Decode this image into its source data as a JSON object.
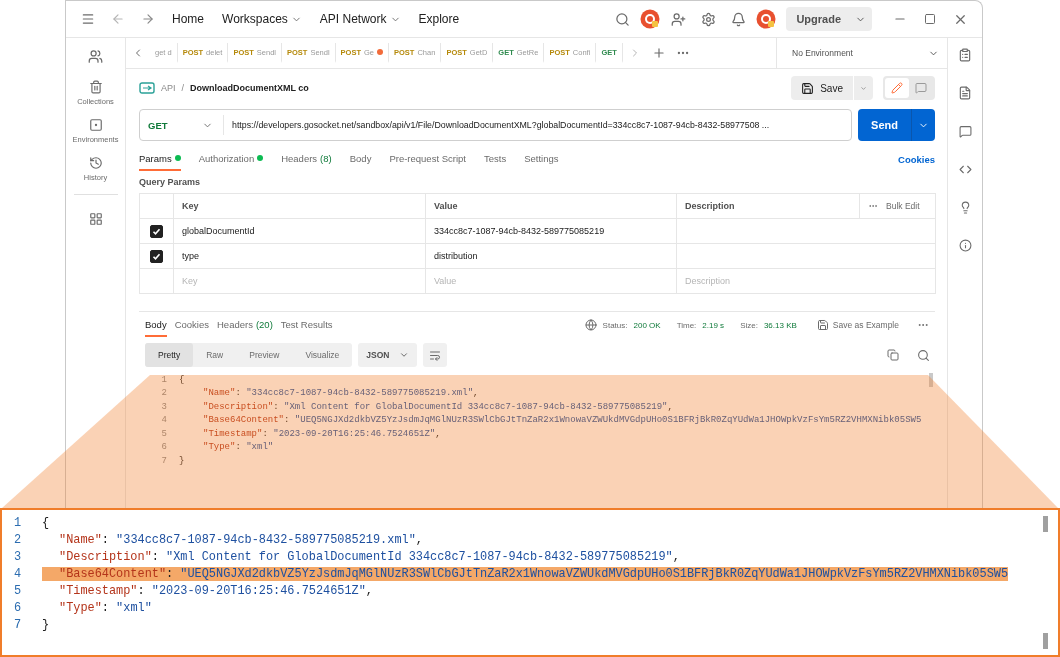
{
  "topbar": {
    "nav": [
      {
        "label": "Home",
        "dropdown": false
      },
      {
        "label": "Workspaces",
        "dropdown": true
      },
      {
        "label": "API Network",
        "dropdown": true
      },
      {
        "label": "Explore",
        "dropdown": false
      }
    ],
    "upgrade": "Upgrade"
  },
  "sidebar": {
    "items": [
      {
        "label": "Collections"
      },
      {
        "label": "Environments"
      },
      {
        "label": "History"
      }
    ]
  },
  "tabs": [
    {
      "name": "get d",
      "selected": false,
      "unsaved": false
    },
    {
      "method": "POST",
      "color": "#b5890a",
      "name": "delet",
      "selected": false,
      "unsaved": false
    },
    {
      "method": "POST",
      "color": "#b5890a",
      "name": "Sendl",
      "selected": false,
      "unsaved": false
    },
    {
      "method": "POST",
      "color": "#b5890a",
      "name": "Sendl",
      "selected": false,
      "unsaved": false
    },
    {
      "method": "POST",
      "color": "#b5890a",
      "name": "Ge",
      "selected": false,
      "unsaved": true
    },
    {
      "method": "POST",
      "color": "#b5890a",
      "name": "Chan",
      "selected": false,
      "unsaved": false
    },
    {
      "method": "POST",
      "color": "#b5890a",
      "name": "GetD",
      "selected": false,
      "unsaved": false
    },
    {
      "method": "GET",
      "color": "#2f8a4e",
      "name": "GetRe",
      "selected": false,
      "unsaved": false
    },
    {
      "method": "POST",
      "color": "#b5890a",
      "name": "Confi",
      "selected": false,
      "unsaved": false
    },
    {
      "method": "GET",
      "color": "#2f8a4e",
      "selected": false,
      "unsaved": false
    }
  ],
  "environment": "No Environment",
  "breadcrumb": {
    "parent": "API",
    "separator": "/",
    "name": "DownloadDocumentXML co"
  },
  "save": "Save",
  "request": {
    "method": "GET",
    "url": "https://developers.gosocket.net/sandbox/api/v1/File/DownloadDocumentXML?globalDocumentId=334cc8c7-1087-94cb-8432-58977508 ...",
    "send": "Send"
  },
  "request_tabs": [
    {
      "label": "Params",
      "dot": true,
      "selected": true
    },
    {
      "label": "Authorization",
      "dot": true,
      "selected": false
    },
    {
      "label": "Headers",
      "count": "(8)",
      "dot": false,
      "selected": false
    },
    {
      "label": "Body",
      "dot": false,
      "selected": false
    },
    {
      "label": "Pre-request Script",
      "dot": false,
      "selected": false
    },
    {
      "label": "Tests",
      "dot": false,
      "selected": false
    },
    {
      "label": "Settings",
      "dot": false,
      "selected": false
    }
  ],
  "cookies": "Cookies",
  "query_params": {
    "title": "Query Params",
    "columns": [
      "Key",
      "Value",
      "Description"
    ],
    "bulk_edit": "Bulk Edit",
    "rows": [
      {
        "checked": true,
        "key": "globalDocumentId",
        "value": "334cc8c7-1087-94cb-8432-589775085219"
      },
      {
        "checked": true,
        "key": "type",
        "value": "distribution"
      }
    ],
    "new_row": {
      "key_placeholder": "Key",
      "value_placeholder": "Value",
      "description_placeholder": "Description"
    }
  },
  "response": {
    "tabs": [
      {
        "label": "Body",
        "selected": true
      },
      {
        "label": "Cookies",
        "selected": false
      },
      {
        "label": "Headers",
        "count": "(20)",
        "selected": false
      },
      {
        "label": "Test Results",
        "selected": false
      }
    ],
    "status_label": "Status:",
    "status": "200 OK",
    "time_label": "Time:",
    "time": "2.19 s",
    "size_label": "Size:",
    "size": "36.13 KB",
    "save_example": "Save as Example",
    "view_modes": [
      {
        "label": "Pretty",
        "selected": true
      },
      {
        "label": "Raw",
        "selected": false
      },
      {
        "label": "Preview",
        "selected": false
      },
      {
        "label": "Visualize",
        "selected": false
      }
    ],
    "format": "JSON",
    "lines": [
      {
        "number": "1",
        "tokens": [
          {
            "kind": "punct",
            "text": "{"
          }
        ]
      },
      {
        "number": "2",
        "tokens": [
          {
            "kind": "key",
            "text": "\"Name\""
          },
          {
            "kind": "punct",
            "text": ": "
          },
          {
            "kind": "string",
            "text": "\"334cc8c7-1087-94cb-8432-589775085219.xml\""
          },
          {
            "kind": "punct",
            "text": ","
          }
        ]
      },
      {
        "number": "3",
        "tokens": [
          {
            "kind": "key",
            "text": "\"Description\""
          },
          {
            "kind": "punct",
            "text": ": "
          },
          {
            "kind": "string",
            "text": "\"Xml Content for GlobalDocumentId 334cc8c7-1087-94cb-8432-589775085219\""
          },
          {
            "kind": "punct",
            "text": ","
          }
        ]
      },
      {
        "number": "4",
        "tokens": [
          {
            "kind": "key",
            "text": "\"Base64Content\""
          },
          {
            "kind": "punct",
            "text": ": "
          },
          {
            "kind": "string",
            "text": "\"UEQ5NGJXd2dkbVZ5YzJsdmJqMGlNUzR3SWlCbGJtTnZaR2x1WnowaVZWUkdMVGdpUHo0S1BFRjBkR0ZqYUdWa1JHOWpkVzFsYm5RZ2VHMXNibk05SW5"
          }
        ]
      },
      {
        "number": "5",
        "tokens": [
          {
            "kind": "key",
            "text": "\"Timestamp\""
          },
          {
            "kind": "punct",
            "text": ": "
          },
          {
            "kind": "string",
            "text": "\"2023-09-20T16:25:46.7524651Z\""
          },
          {
            "kind": "punct",
            "text": ","
          }
        ]
      },
      {
        "number": "6",
        "tokens": [
          {
            "kind": "key",
            "text": "\"Type\""
          },
          {
            "kind": "punct",
            "text": ": "
          },
          {
            "kind": "string",
            "text": "\"xml\""
          }
        ]
      },
      {
        "number": "7",
        "tokens": [
          {
            "kind": "punct",
            "text": "}"
          }
        ]
      }
    ]
  },
  "zoom_panel": {
    "lines": [
      {
        "number": "1",
        "highlighted": false,
        "tokens": [
          {
            "kind": "punct",
            "text": "{"
          }
        ]
      },
      {
        "number": "2",
        "highlighted": false,
        "tokens": [
          {
            "kind": "key",
            "text": "\"Name\""
          },
          {
            "kind": "punct",
            "text": ": "
          },
          {
            "kind": "string",
            "text": "\"334cc8c7-1087-94cb-8432-589775085219.xml\""
          },
          {
            "kind": "punct",
            "text": ","
          }
        ]
      },
      {
        "number": "3",
        "highlighted": false,
        "tokens": [
          {
            "kind": "key",
            "text": "\"Description\""
          },
          {
            "kind": "punct",
            "text": ": "
          },
          {
            "kind": "string",
            "text": "\"Xml Content for GlobalDocumentId 334cc8c7-1087-94cb-8432-589775085219\""
          },
          {
            "kind": "punct",
            "text": ","
          }
        ]
      },
      {
        "number": "4",
        "highlighted": true,
        "tokens": [
          {
            "kind": "key",
            "text": "\"Base64Content\""
          },
          {
            "kind": "punct",
            "text": ": "
          },
          {
            "kind": "string",
            "text": "\"UEQ5NGJXd2dkbVZ5YzJsdmJqMGlNUzR3SWlCbGJtTnZaR2x1WnowaVZWUkdMVGdpUHo0S1BFRjBkR0ZqYUdWa1JHOWpkVzFsYm5RZ2VHMXNibk05SW5"
          }
        ]
      },
      {
        "number": "5",
        "highlighted": false,
        "tokens": [
          {
            "kind": "key",
            "text": "\"Timestamp\""
          },
          {
            "kind": "punct",
            "text": ": "
          },
          {
            "kind": "string",
            "text": "\"2023-09-20T16:25:46.7524651Z\""
          },
          {
            "kind": "punct",
            "text": ","
          }
        ]
      },
      {
        "number": "6",
        "highlighted": false,
        "tokens": [
          {
            "kind": "key",
            "text": "\"Type\""
          },
          {
            "kind": "punct",
            "text": ": "
          },
          {
            "kind": "string",
            "text": "\"xml\""
          }
        ]
      },
      {
        "number": "7",
        "highlighted": false,
        "tokens": [
          {
            "kind": "punct",
            "text": "}"
          }
        ]
      }
    ]
  }
}
